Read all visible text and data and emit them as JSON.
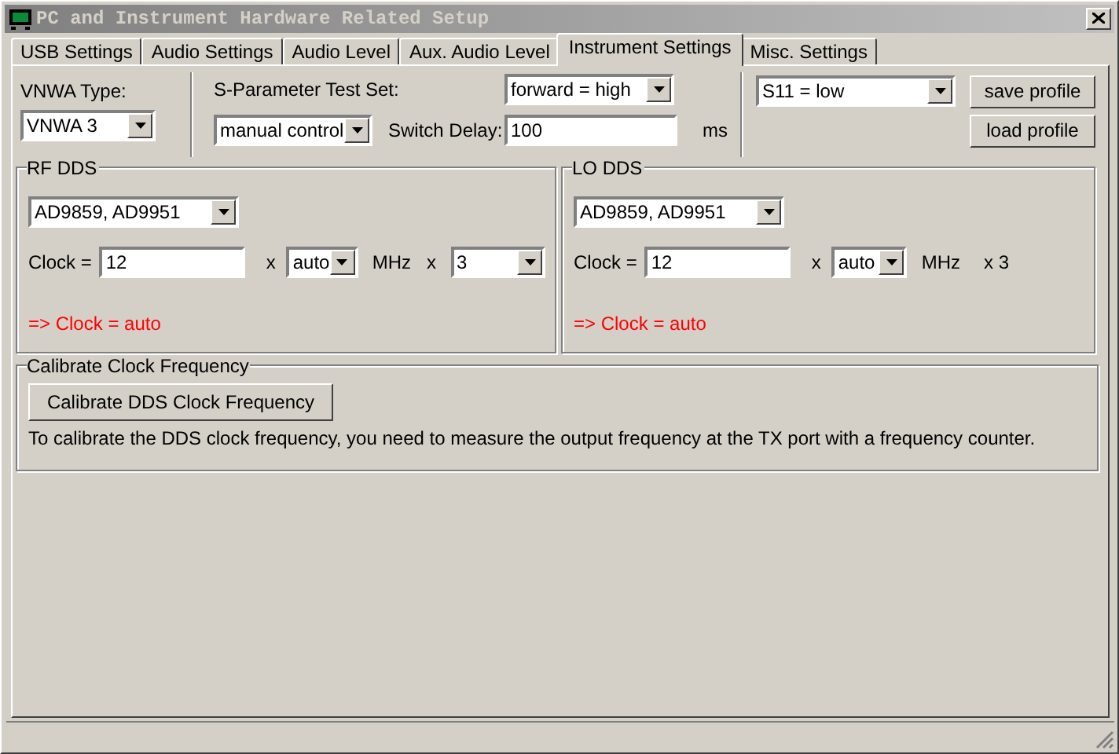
{
  "window": {
    "title": "PC and Instrument Hardware Related Setup"
  },
  "tabs": [
    {
      "label": "USB Settings",
      "selected": false
    },
    {
      "label": "Audio Settings",
      "selected": false
    },
    {
      "label": "Audio Level",
      "selected": false
    },
    {
      "label": "Aux. Audio Level",
      "selected": false
    },
    {
      "label": "Instrument Settings",
      "selected": true
    },
    {
      "label": "Misc. Settings",
      "selected": false
    }
  ],
  "vnwa_type": {
    "label": "VNWA Type:",
    "value": "VNWA 3"
  },
  "test_set": {
    "label": "S-Parameter Test Set:",
    "direction": "forward = high",
    "mode": "manual control",
    "switch_delay_label": "Switch Delay:",
    "switch_delay": "100",
    "unit": "ms",
    "s11": "S11 = low"
  },
  "buttons": [
    "save profile",
    "load profile"
  ],
  "dds": [
    {
      "title": "RF DDS",
      "chip": "AD9859, AD9951",
      "clock_label": "Clock =",
      "clock": "12",
      "times": "x",
      "multiplier_mode": "auto",
      "unit": "MHz",
      "factor": {
        "kind": "dropdown",
        "times": "x",
        "value": "3"
      },
      "result": "=> Clock = auto"
    },
    {
      "title": "LO DDS",
      "chip": "AD9859, AD9951",
      "clock_label": "Clock =",
      "clock": "12",
      "times": "x",
      "multiplier_mode": "auto",
      "unit": "MHz",
      "factor": {
        "kind": "text",
        "text": "x 3"
      },
      "result": "=> Clock = auto"
    }
  ],
  "calibrate": {
    "title": "Calibrate Clock Frequency",
    "button": "Calibrate DDS Clock Frequency",
    "note": "To calibrate the DDS clock frequency, you need to measure the output frequency at the TX port with a frequency counter."
  }
}
